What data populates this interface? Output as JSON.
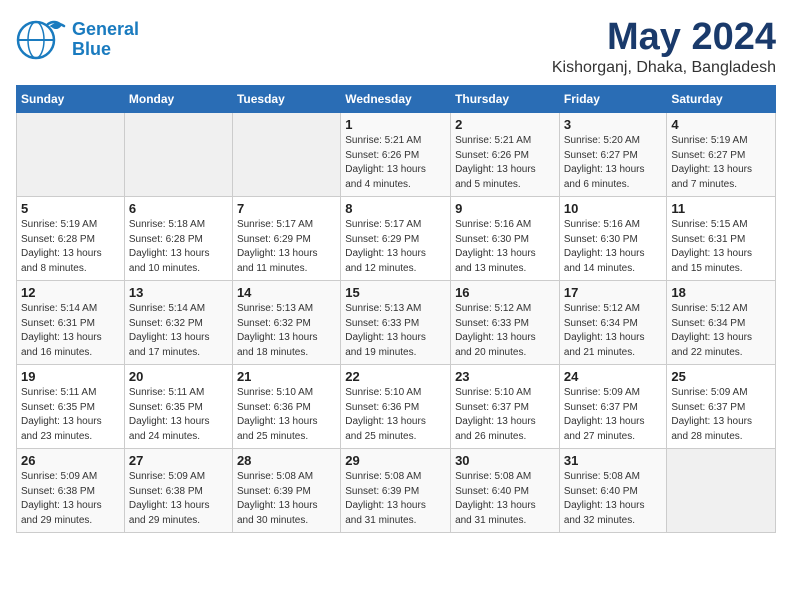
{
  "logo": {
    "line1": "General",
    "line2": "Blue"
  },
  "title": "May 2024",
  "subtitle": "Kishorganj, Dhaka, Bangladesh",
  "days_header": [
    "Sunday",
    "Monday",
    "Tuesday",
    "Wednesday",
    "Thursday",
    "Friday",
    "Saturday"
  ],
  "weeks": [
    [
      {
        "day": "",
        "info": ""
      },
      {
        "day": "",
        "info": ""
      },
      {
        "day": "",
        "info": ""
      },
      {
        "day": "1",
        "info": "Sunrise: 5:21 AM\nSunset: 6:26 PM\nDaylight: 13 hours\nand 4 minutes."
      },
      {
        "day": "2",
        "info": "Sunrise: 5:21 AM\nSunset: 6:26 PM\nDaylight: 13 hours\nand 5 minutes."
      },
      {
        "day": "3",
        "info": "Sunrise: 5:20 AM\nSunset: 6:27 PM\nDaylight: 13 hours\nand 6 minutes."
      },
      {
        "day": "4",
        "info": "Sunrise: 5:19 AM\nSunset: 6:27 PM\nDaylight: 13 hours\nand 7 minutes."
      }
    ],
    [
      {
        "day": "5",
        "info": "Sunrise: 5:19 AM\nSunset: 6:28 PM\nDaylight: 13 hours\nand 8 minutes."
      },
      {
        "day": "6",
        "info": "Sunrise: 5:18 AM\nSunset: 6:28 PM\nDaylight: 13 hours\nand 10 minutes."
      },
      {
        "day": "7",
        "info": "Sunrise: 5:17 AM\nSunset: 6:29 PM\nDaylight: 13 hours\nand 11 minutes."
      },
      {
        "day": "8",
        "info": "Sunrise: 5:17 AM\nSunset: 6:29 PM\nDaylight: 13 hours\nand 12 minutes."
      },
      {
        "day": "9",
        "info": "Sunrise: 5:16 AM\nSunset: 6:30 PM\nDaylight: 13 hours\nand 13 minutes."
      },
      {
        "day": "10",
        "info": "Sunrise: 5:16 AM\nSunset: 6:30 PM\nDaylight: 13 hours\nand 14 minutes."
      },
      {
        "day": "11",
        "info": "Sunrise: 5:15 AM\nSunset: 6:31 PM\nDaylight: 13 hours\nand 15 minutes."
      }
    ],
    [
      {
        "day": "12",
        "info": "Sunrise: 5:14 AM\nSunset: 6:31 PM\nDaylight: 13 hours\nand 16 minutes."
      },
      {
        "day": "13",
        "info": "Sunrise: 5:14 AM\nSunset: 6:32 PM\nDaylight: 13 hours\nand 17 minutes."
      },
      {
        "day": "14",
        "info": "Sunrise: 5:13 AM\nSunset: 6:32 PM\nDaylight: 13 hours\nand 18 minutes."
      },
      {
        "day": "15",
        "info": "Sunrise: 5:13 AM\nSunset: 6:33 PM\nDaylight: 13 hours\nand 19 minutes."
      },
      {
        "day": "16",
        "info": "Sunrise: 5:12 AM\nSunset: 6:33 PM\nDaylight: 13 hours\nand 20 minutes."
      },
      {
        "day": "17",
        "info": "Sunrise: 5:12 AM\nSunset: 6:34 PM\nDaylight: 13 hours\nand 21 minutes."
      },
      {
        "day": "18",
        "info": "Sunrise: 5:12 AM\nSunset: 6:34 PM\nDaylight: 13 hours\nand 22 minutes."
      }
    ],
    [
      {
        "day": "19",
        "info": "Sunrise: 5:11 AM\nSunset: 6:35 PM\nDaylight: 13 hours\nand 23 minutes."
      },
      {
        "day": "20",
        "info": "Sunrise: 5:11 AM\nSunset: 6:35 PM\nDaylight: 13 hours\nand 24 minutes."
      },
      {
        "day": "21",
        "info": "Sunrise: 5:10 AM\nSunset: 6:36 PM\nDaylight: 13 hours\nand 25 minutes."
      },
      {
        "day": "22",
        "info": "Sunrise: 5:10 AM\nSunset: 6:36 PM\nDaylight: 13 hours\nand 25 minutes."
      },
      {
        "day": "23",
        "info": "Sunrise: 5:10 AM\nSunset: 6:37 PM\nDaylight: 13 hours\nand 26 minutes."
      },
      {
        "day": "24",
        "info": "Sunrise: 5:09 AM\nSunset: 6:37 PM\nDaylight: 13 hours\nand 27 minutes."
      },
      {
        "day": "25",
        "info": "Sunrise: 5:09 AM\nSunset: 6:37 PM\nDaylight: 13 hours\nand 28 minutes."
      }
    ],
    [
      {
        "day": "26",
        "info": "Sunrise: 5:09 AM\nSunset: 6:38 PM\nDaylight: 13 hours\nand 29 minutes."
      },
      {
        "day": "27",
        "info": "Sunrise: 5:09 AM\nSunset: 6:38 PM\nDaylight: 13 hours\nand 29 minutes."
      },
      {
        "day": "28",
        "info": "Sunrise: 5:08 AM\nSunset: 6:39 PM\nDaylight: 13 hours\nand 30 minutes."
      },
      {
        "day": "29",
        "info": "Sunrise: 5:08 AM\nSunset: 6:39 PM\nDaylight: 13 hours\nand 31 minutes."
      },
      {
        "day": "30",
        "info": "Sunrise: 5:08 AM\nSunset: 6:40 PM\nDaylight: 13 hours\nand 31 minutes."
      },
      {
        "day": "31",
        "info": "Sunrise: 5:08 AM\nSunset: 6:40 PM\nDaylight: 13 hours\nand 32 minutes."
      },
      {
        "day": "",
        "info": ""
      }
    ]
  ]
}
